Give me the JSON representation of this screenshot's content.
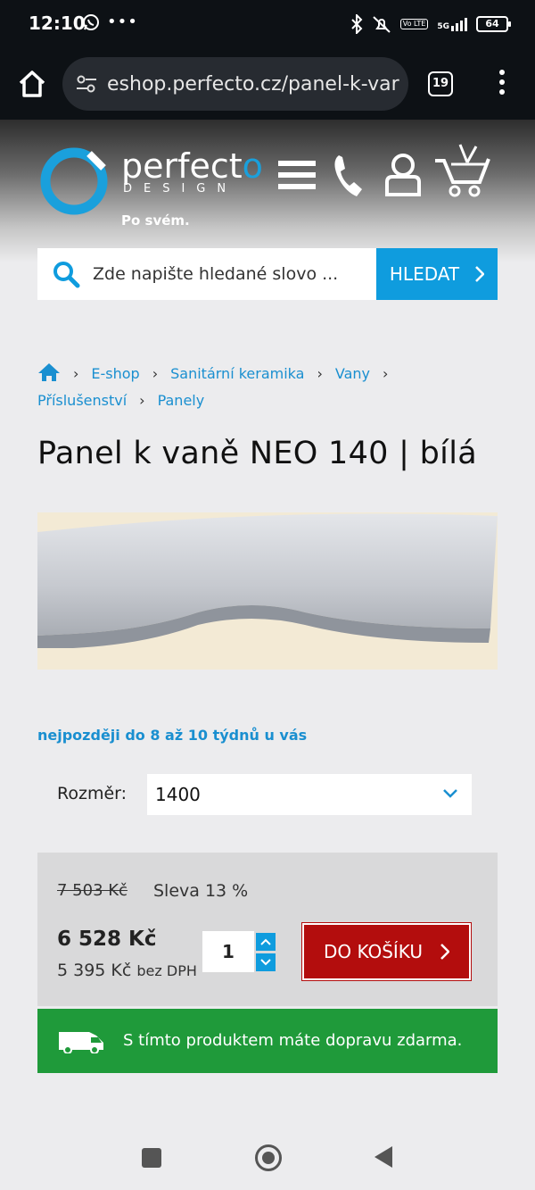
{
  "status_bar": {
    "time": "12:10",
    "left_icons": [
      "whatsapp-icon",
      "more-dots-icon"
    ],
    "right_icons": [
      "bluetooth-icon",
      "mute-icon",
      "volte-icon",
      "signal-5g-icon"
    ],
    "volte_label": "Vo LTE",
    "network_label": "5G",
    "battery": "64"
  },
  "browser": {
    "url": "eshop.perfecto.cz/panel-k-var",
    "tab_count": "19"
  },
  "site": {
    "logo_text": "perfecto",
    "logo_subtext": "DESIGN",
    "tagline": "Po svém.",
    "accent_color": "#1aa0dc"
  },
  "search": {
    "placeholder": "Zde napište hledané slovo ...",
    "button_label": "HLEDAT"
  },
  "breadcrumb": {
    "items": [
      "E-shop",
      "Sanitární keramika",
      "Vany",
      "Příslušenství",
      "Panely"
    ]
  },
  "product": {
    "title": "Panel k vaně NEO 140 | bílá",
    "delivery": "nejpozději do 8 až 10 týdnů u vás",
    "size_label": "Rozměr:",
    "size_value": "1400",
    "old_price": "7 503 Kč",
    "discount": "Sleva 13 %",
    "price": "6 528 Kč",
    "price_net": "5 395 Kč",
    "price_net_suffix": "bez DPH",
    "quantity": "1",
    "add_to_cart": "DO KOŠÍKU",
    "shipping_note": "S tímto produktem máte dopravu zdarma.",
    "cart_color": "#b30d0d",
    "shipping_color": "#1f9a3a"
  }
}
